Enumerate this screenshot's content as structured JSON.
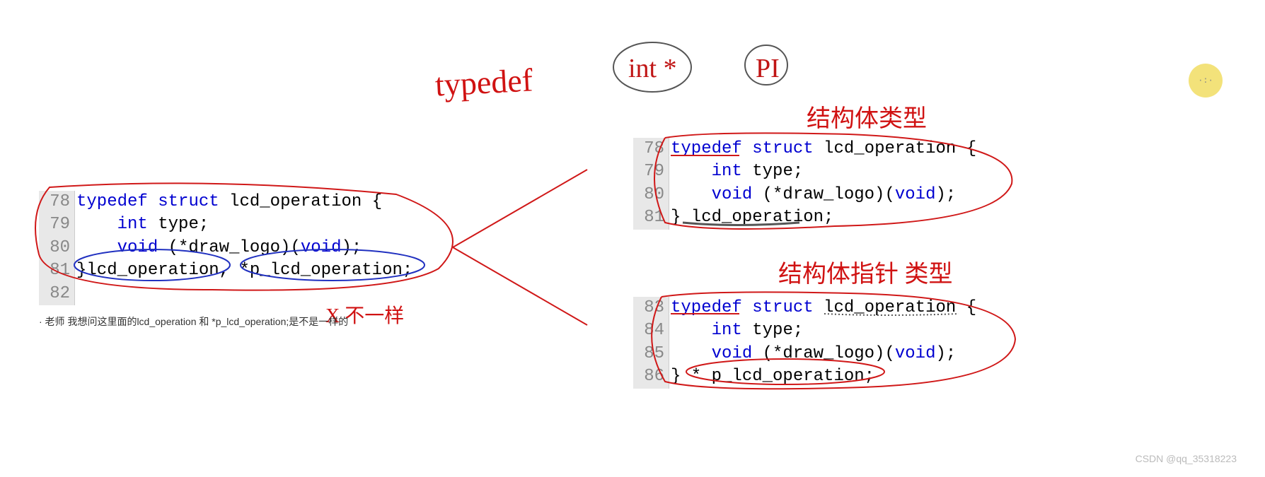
{
  "handwriting": {
    "typedef": "typedef",
    "intstar": "int *",
    "pi": "PI",
    "struct_type": "结构体类型",
    "struct_ptr_type": "结构体指针 类型",
    "not_same": "X 不一样"
  },
  "question": "· 老师 我想问这里面的lcd_operation 和 *p_lcd_operation;是不是一样的",
  "watermark": "CSDN @qq_35318223",
  "block1": {
    "lines": [
      {
        "num": "78",
        "tokens": [
          {
            "t": "typedef",
            "c": "kw"
          },
          {
            "t": " ",
            "c": "txt"
          },
          {
            "t": "struct",
            "c": "kw"
          },
          {
            "t": " lcd_operation {",
            "c": "txt"
          }
        ]
      },
      {
        "num": "79",
        "tokens": [
          {
            "t": "    ",
            "c": "txt"
          },
          {
            "t": "int",
            "c": "ty"
          },
          {
            "t": " type;",
            "c": "txt"
          }
        ]
      },
      {
        "num": "80",
        "tokens": [
          {
            "t": "    ",
            "c": "txt"
          },
          {
            "t": "void",
            "c": "ty"
          },
          {
            "t": " (*draw_logo)(",
            "c": "txt"
          },
          {
            "t": "void",
            "c": "ty"
          },
          {
            "t": ");",
            "c": "txt"
          }
        ]
      },
      {
        "num": "81",
        "tokens": [
          {
            "t": "}lcd_operation, *p_lcd_operation;",
            "c": "txt"
          }
        ]
      },
      {
        "num": "82",
        "tokens": [
          {
            "t": "",
            "c": "txt"
          }
        ]
      }
    ]
  },
  "block2": {
    "lines": [
      {
        "num": "78",
        "tokens": [
          {
            "t": "typedef",
            "c": "kw"
          },
          {
            "t": " ",
            "c": "txt"
          },
          {
            "t": "struct",
            "c": "kw"
          },
          {
            "t": " lcd_operation {",
            "c": "txt"
          }
        ]
      },
      {
        "num": "79",
        "tokens": [
          {
            "t": "    ",
            "c": "txt"
          },
          {
            "t": "int",
            "c": "ty"
          },
          {
            "t": " type;",
            "c": "txt"
          }
        ]
      },
      {
        "num": "80",
        "tokens": [
          {
            "t": "    ",
            "c": "txt"
          },
          {
            "t": "void",
            "c": "ty"
          },
          {
            "t": " (*draw_logo)(",
            "c": "txt"
          },
          {
            "t": "void",
            "c": "ty"
          },
          {
            "t": ");",
            "c": "txt"
          }
        ]
      },
      {
        "num": "81",
        "tokens": [
          {
            "t": "} lcd_operation;",
            "c": "txt"
          }
        ]
      }
    ]
  },
  "block3": {
    "lines": [
      {
        "num": "83",
        "tokens": [
          {
            "t": "typedef",
            "c": "kw"
          },
          {
            "t": " ",
            "c": "txt"
          },
          {
            "t": "struct",
            "c": "kw"
          },
          {
            "t": " lcd_operation {",
            "c": "txt"
          }
        ]
      },
      {
        "num": "84",
        "tokens": [
          {
            "t": "    ",
            "c": "txt"
          },
          {
            "t": "int",
            "c": "ty"
          },
          {
            "t": " type;",
            "c": "txt"
          }
        ]
      },
      {
        "num": "85",
        "tokens": [
          {
            "t": "    ",
            "c": "txt"
          },
          {
            "t": "void",
            "c": "ty"
          },
          {
            "t": " (*draw_logo)(",
            "c": "txt"
          },
          {
            "t": "void",
            "c": "ty"
          },
          {
            "t": ");",
            "c": "txt"
          }
        ]
      },
      {
        "num": "86",
        "tokens": [
          {
            "t": "} * p_lcd_operation;",
            "c": "txt"
          }
        ]
      }
    ]
  }
}
